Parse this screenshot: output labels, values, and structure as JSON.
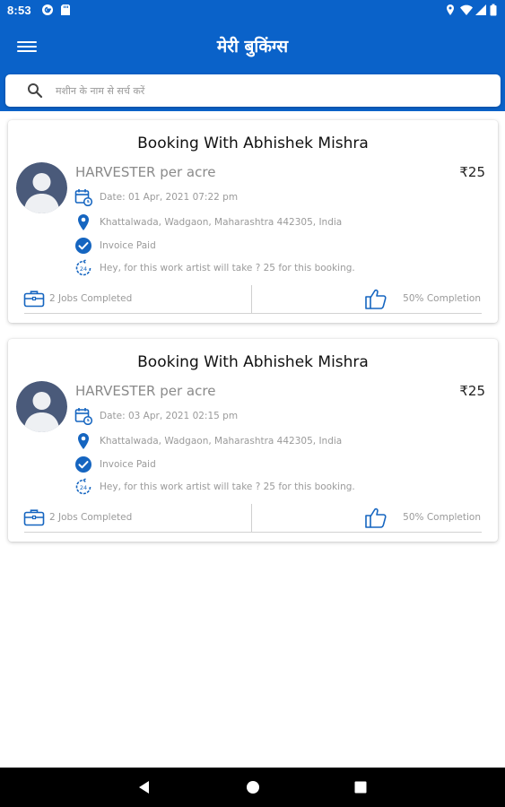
{
  "status_bar": {
    "time": "8:53",
    "icons": [
      "google-g-icon",
      "sd-card-icon",
      "location-icon",
      "wifi-icon",
      "signal-icon",
      "battery-icon"
    ]
  },
  "app_bar": {
    "title": "मेरी बुकिंग्स",
    "menu_icon": "hamburger-menu-icon",
    "color": "#0a62c9"
  },
  "search": {
    "placeholder": "मशीन के नाम से सर्च करें",
    "icon": "search-icon"
  },
  "bookings": [
    {
      "title": "Booking With Abhishek Mishra",
      "service": "HARVESTER per acre",
      "price": "₹25",
      "date": "Date: 01 Apr, 2021 07:22 pm",
      "address": "Khattalwada, Wadgaon, Maharashtra 442305, India",
      "invoice": "Invoice Paid",
      "eta": "Hey, for this work artist will take ? 25 for this booking.",
      "jobs": "2 Jobs Completed",
      "completion": "50% Completion"
    },
    {
      "title": "Booking With Abhishek Mishra",
      "service": "HARVESTER per acre",
      "price": "₹25",
      "date": "Date: 03 Apr, 2021 02:15 pm",
      "address": "Khattalwada, Wadgaon, Maharashtra 442305, India",
      "invoice": "Invoice Paid",
      "eta": "Hey, for this work artist will take ? 25 for this booking.",
      "jobs": "2 Jobs Completed",
      "completion": "50% Completion"
    }
  ],
  "colors": {
    "primary": "#0a62c9",
    "muted_text": "#9a9a9a",
    "avatar_fill": "#4a5a7a"
  },
  "nav_bar": {
    "buttons": [
      "back-icon",
      "home-icon",
      "recents-icon"
    ]
  }
}
